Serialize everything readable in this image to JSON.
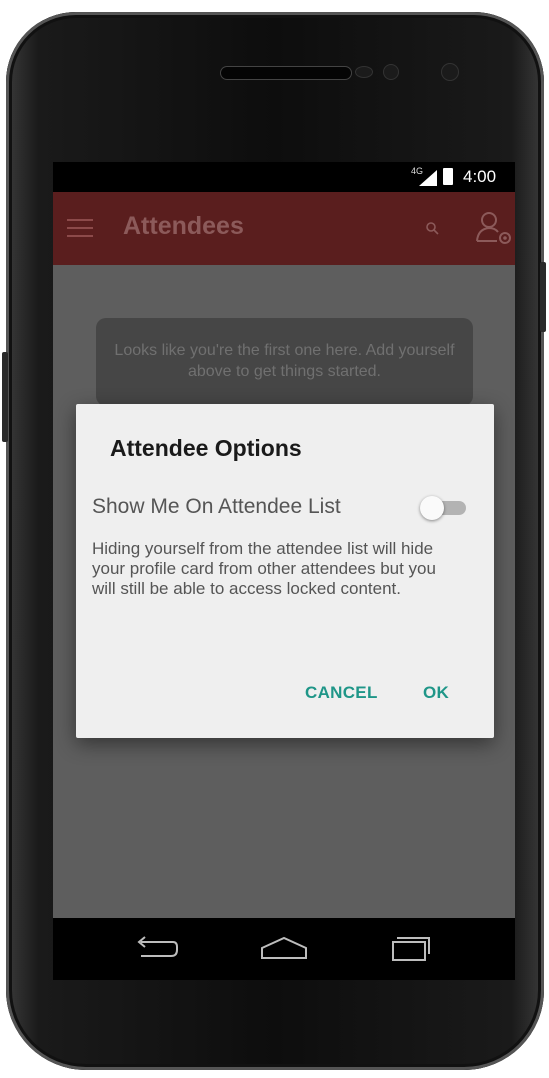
{
  "status_bar": {
    "network": "4G",
    "time": "4:00"
  },
  "app_bar": {
    "title": "Attendees"
  },
  "content": {
    "empty_message": "Looks like you're the first one here. Add yourself above to get things started."
  },
  "dialog": {
    "title": "Attendee Options",
    "toggle_label": "Show Me On Attendee List",
    "toggle_on": false,
    "body": "Hiding yourself from the attendee list will hide your profile card from other attendees but you will still be able to access locked content.",
    "cancel_label": "CANCEL",
    "ok_label": "OK"
  },
  "colors": {
    "app_bar": "#5a1e1e",
    "accent": "#1f9688",
    "dialog_bg": "#efefef"
  },
  "icons": [
    "menu-icon",
    "search-icon",
    "account-settings-icon",
    "back-icon",
    "home-icon",
    "recents-icon"
  ]
}
